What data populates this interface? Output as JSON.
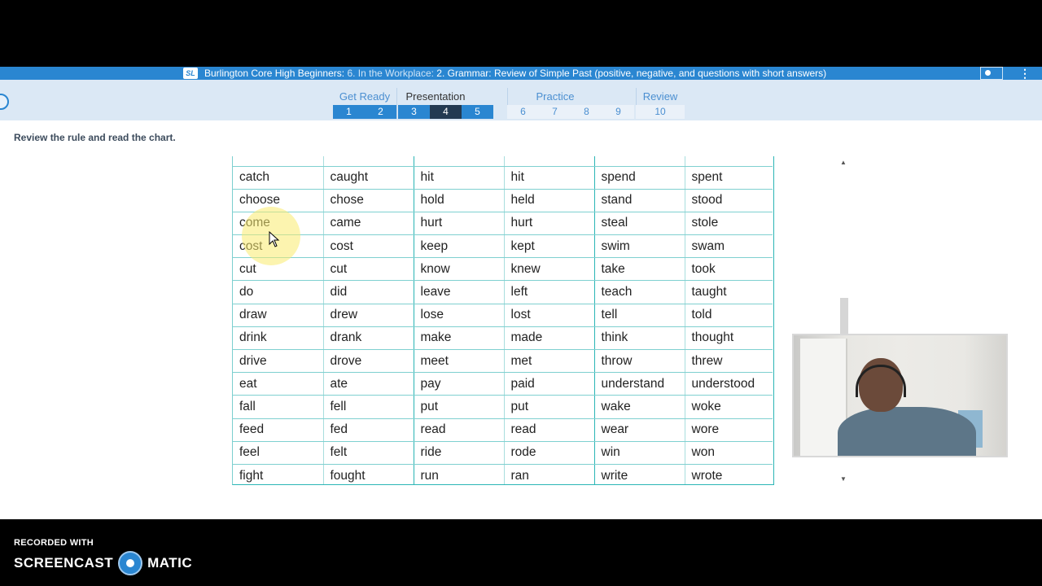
{
  "header": {
    "logo_text": "SL",
    "course": "Burlington Core High Beginners:",
    "unit": "6. In the Workplace:",
    "lesson": "2. Grammar: Review of Simple Past (positive, negative, and questions with short answers)"
  },
  "nav": {
    "groups": [
      {
        "label": "Get Ready",
        "steps": [
          "1",
          "2"
        ]
      },
      {
        "label": "Presentation",
        "steps": [
          "3",
          "4",
          "5"
        ]
      },
      {
        "label": "Practice",
        "steps": [
          "6",
          "7",
          "8",
          "9"
        ]
      },
      {
        "label": "Review",
        "steps": [
          "10"
        ]
      }
    ],
    "current_step": "4"
  },
  "instruction": "Review the rule and read the chart.",
  "verb_chart": {
    "rows": [
      [
        "catch",
        "caught",
        "hit",
        "hit",
        "spend",
        "spent"
      ],
      [
        "choose",
        "chose",
        "hold",
        "held",
        "stand",
        "stood"
      ],
      [
        "come",
        "came",
        "hurt",
        "hurt",
        "steal",
        "stole"
      ],
      [
        "cost",
        "cost",
        "keep",
        "kept",
        "swim",
        "swam"
      ],
      [
        "cut",
        "cut",
        "know",
        "knew",
        "take",
        "took"
      ],
      [
        "do",
        "did",
        "leave",
        "left",
        "teach",
        "taught"
      ],
      [
        "draw",
        "drew",
        "lose",
        "lost",
        "tell",
        "told"
      ],
      [
        "drink",
        "drank",
        "make",
        "made",
        "think",
        "thought"
      ],
      [
        "drive",
        "drove",
        "meet",
        "met",
        "throw",
        "threw"
      ],
      [
        "eat",
        "ate",
        "pay",
        "paid",
        "understand",
        "understood"
      ],
      [
        "fall",
        "fell",
        "put",
        "put",
        "wake",
        "woke"
      ],
      [
        "feed",
        "fed",
        "read",
        "read",
        "wear",
        "wore"
      ],
      [
        "feel",
        "felt",
        "ride",
        "rode",
        "win",
        "won"
      ],
      [
        "fight",
        "fought",
        "run",
        "ran",
        "write",
        "wrote"
      ]
    ]
  },
  "recorder": {
    "label": "RECORDED WITH",
    "brand_left": "SCREENCAST",
    "brand_right": "MATIC"
  },
  "icons": {
    "profile": "profile-card-icon",
    "more": "more-vertical-icon",
    "scroll_up": "triangle-up-icon",
    "scroll_down": "triangle-down-icon"
  },
  "colors": {
    "accent_blue": "#2a86d1",
    "current_step": "#233a52",
    "table_rule": "#2bb5b5"
  }
}
